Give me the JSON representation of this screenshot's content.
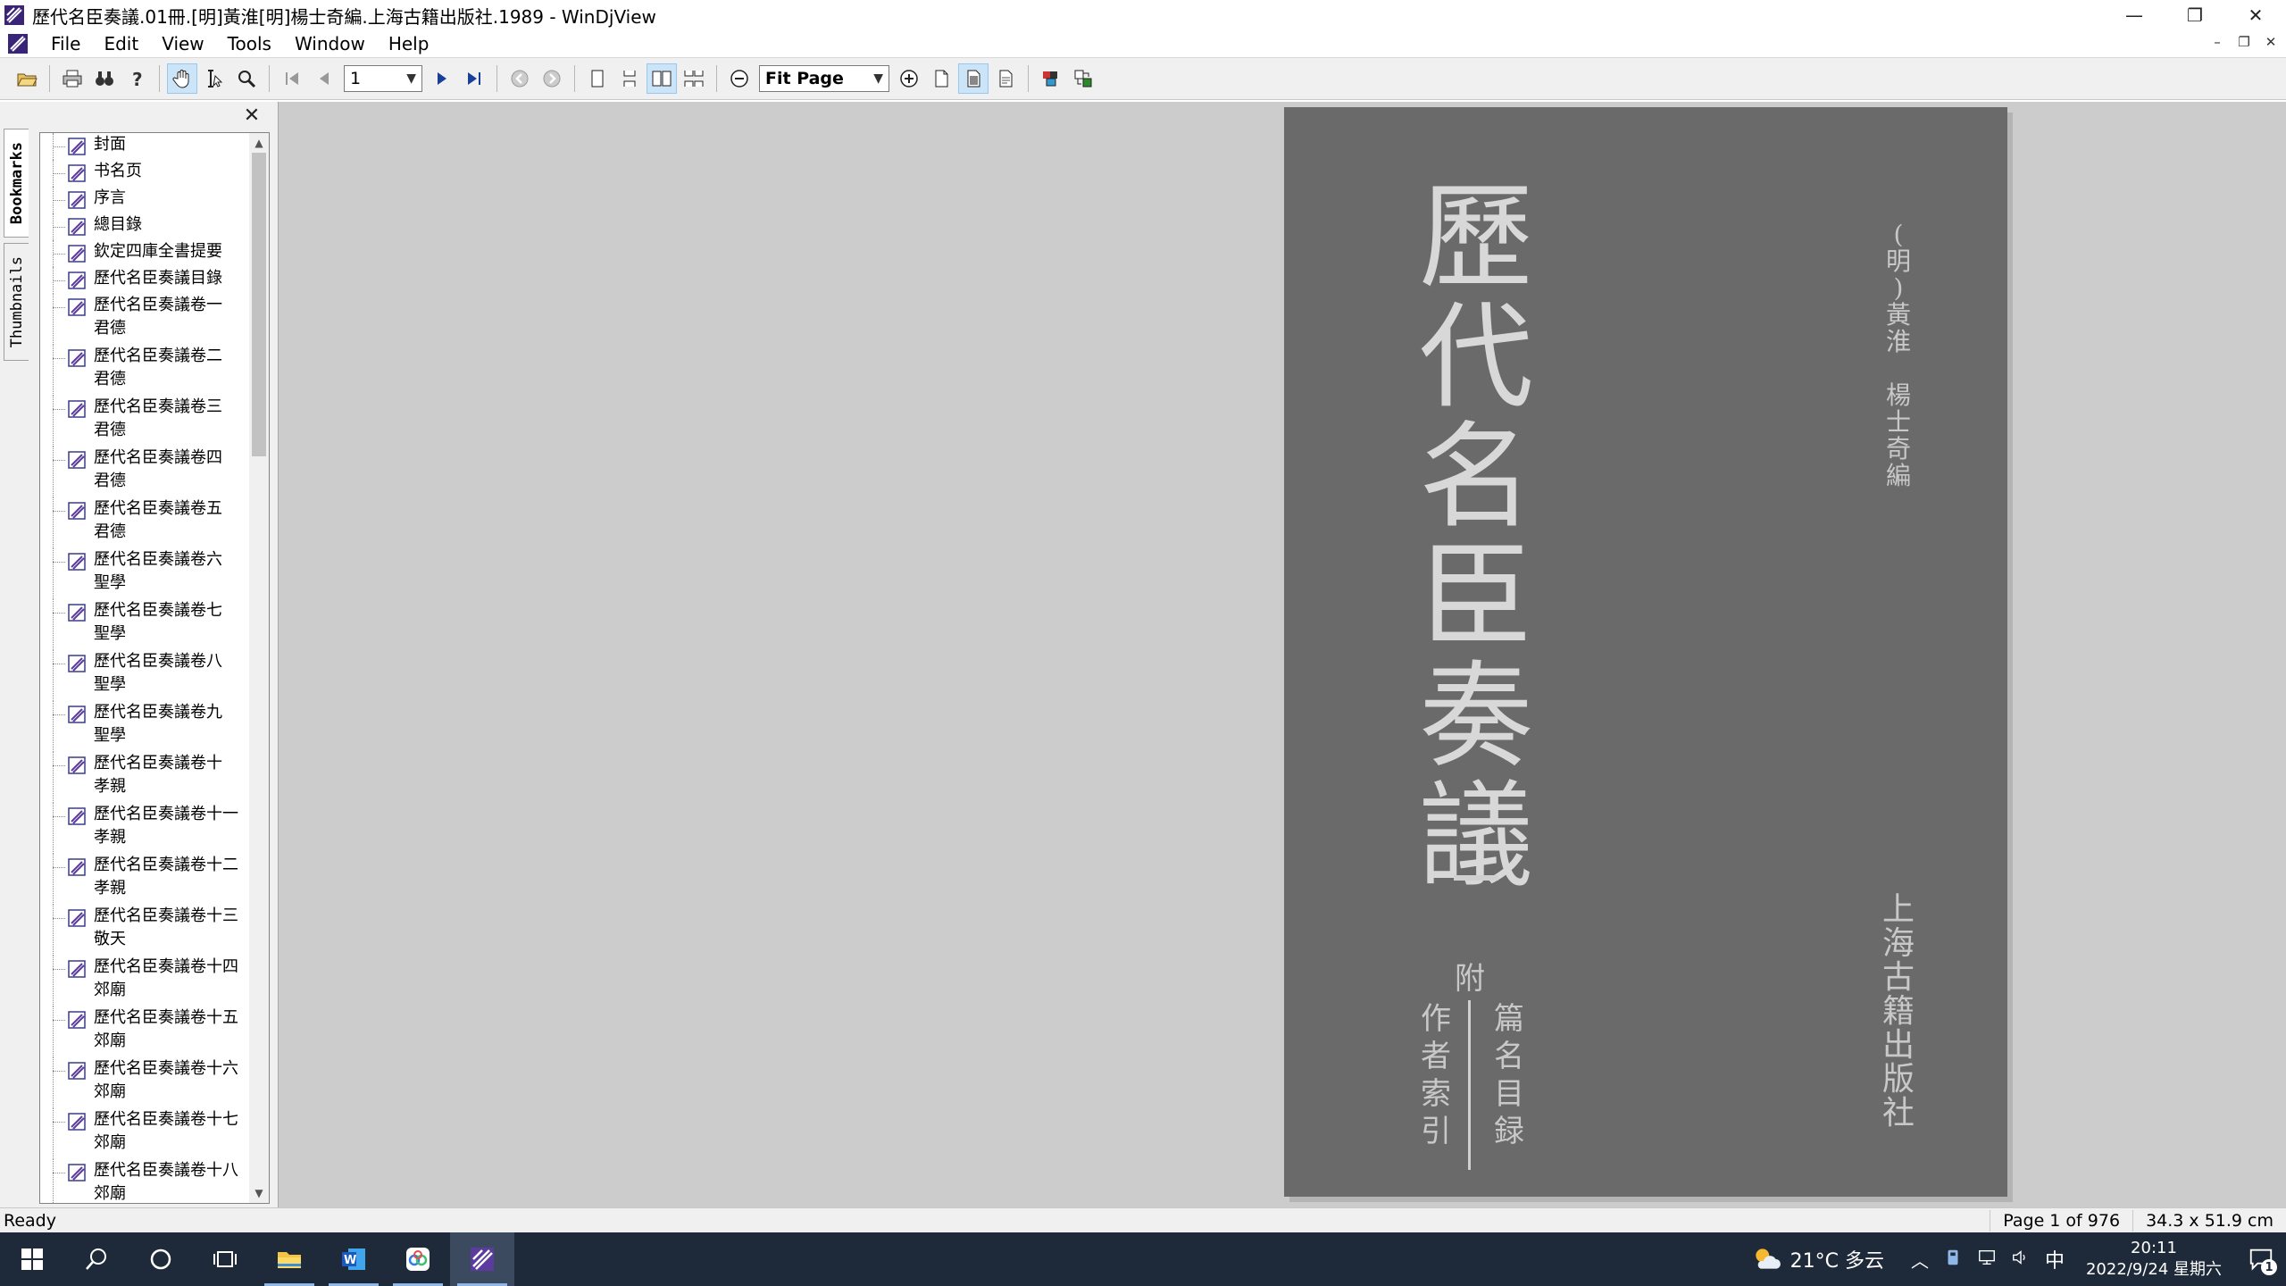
{
  "window": {
    "title": "歷代名臣奏議.01冊.[明]黃淮[明]楊士奇編.上海古籍出版社.1989 - WinDjView",
    "minimize": "—",
    "restore": "❐",
    "close": "✕"
  },
  "menu": {
    "items": [
      "File",
      "Edit",
      "View",
      "Tools",
      "Window",
      "Help"
    ],
    "mdi": [
      "–",
      "❐",
      "✕"
    ]
  },
  "toolbar": {
    "page_value": "1",
    "zoom_value": "Fit Page"
  },
  "sidetabs": {
    "bookmarks": "Bookmarks",
    "thumbnails": "Thumbnails"
  },
  "panel": {
    "close": "✕"
  },
  "bookmarks": [
    {
      "lines": [
        "封面"
      ]
    },
    {
      "lines": [
        "书名页"
      ]
    },
    {
      "lines": [
        "序言"
      ]
    },
    {
      "lines": [
        "總目錄"
      ]
    },
    {
      "lines": [
        "欽定四庫全書提要"
      ]
    },
    {
      "lines": [
        "歷代名臣奏議目錄"
      ]
    },
    {
      "lines": [
        "歷代名臣奏議卷一",
        "君德"
      ]
    },
    {
      "lines": [
        "歷代名臣奏議卷二",
        "君德"
      ]
    },
    {
      "lines": [
        "歷代名臣奏議卷三",
        "君德"
      ]
    },
    {
      "lines": [
        "歷代名臣奏議卷四",
        "君德"
      ]
    },
    {
      "lines": [
        "歷代名臣奏議卷五",
        "君德"
      ]
    },
    {
      "lines": [
        "歷代名臣奏議卷六",
        "聖學"
      ]
    },
    {
      "lines": [
        "歷代名臣奏議卷七",
        "聖學"
      ]
    },
    {
      "lines": [
        "歷代名臣奏議卷八",
        "聖學"
      ]
    },
    {
      "lines": [
        "歷代名臣奏議卷九",
        "聖學"
      ]
    },
    {
      "lines": [
        "歷代名臣奏議卷十",
        "孝親"
      ]
    },
    {
      "lines": [
        "歷代名臣奏議卷十一",
        "孝親"
      ]
    },
    {
      "lines": [
        "歷代名臣奏議卷十二",
        "孝親"
      ]
    },
    {
      "lines": [
        "歷代名臣奏議卷十三",
        "敬天"
      ]
    },
    {
      "lines": [
        "歷代名臣奏議卷十四",
        "郊廟"
      ]
    },
    {
      "lines": [
        "歷代名臣奏議卷十五",
        "郊廟"
      ]
    },
    {
      "lines": [
        "歷代名臣奏議卷十六",
        "郊廟"
      ]
    },
    {
      "lines": [
        "歷代名臣奏議卷十七",
        "郊廟"
      ]
    },
    {
      "lines": [
        "歷代名臣奏議卷十八",
        "郊廟"
      ]
    }
  ],
  "page": {
    "title": "歷\n代\n名\n臣\n奏\n議",
    "authors": "(\n明\n)\n黃\n淮\n\n楊\n士\n奇\n編",
    "publisher": "上\n海\n古\n籍\n出\n版\n社",
    "fu": "附",
    "col_a": "篇\n名\n目\n録",
    "col_b": "作\n者\n索\n引"
  },
  "status": {
    "left": "Ready",
    "page_info": "Page 1 of 976",
    "size_info": "34.3 x 51.9 cm"
  },
  "taskbar": {
    "weather": "21°C 多云",
    "ime": "中",
    "time": "20:11",
    "date": "2022/9/24 星期六",
    "notifications": "1"
  },
  "colors": {
    "page_bg": "#6a6a6a",
    "view_bg": "#cccccc",
    "taskbar_bg": "#1e2a3a",
    "accent": "#5b3c9e"
  }
}
